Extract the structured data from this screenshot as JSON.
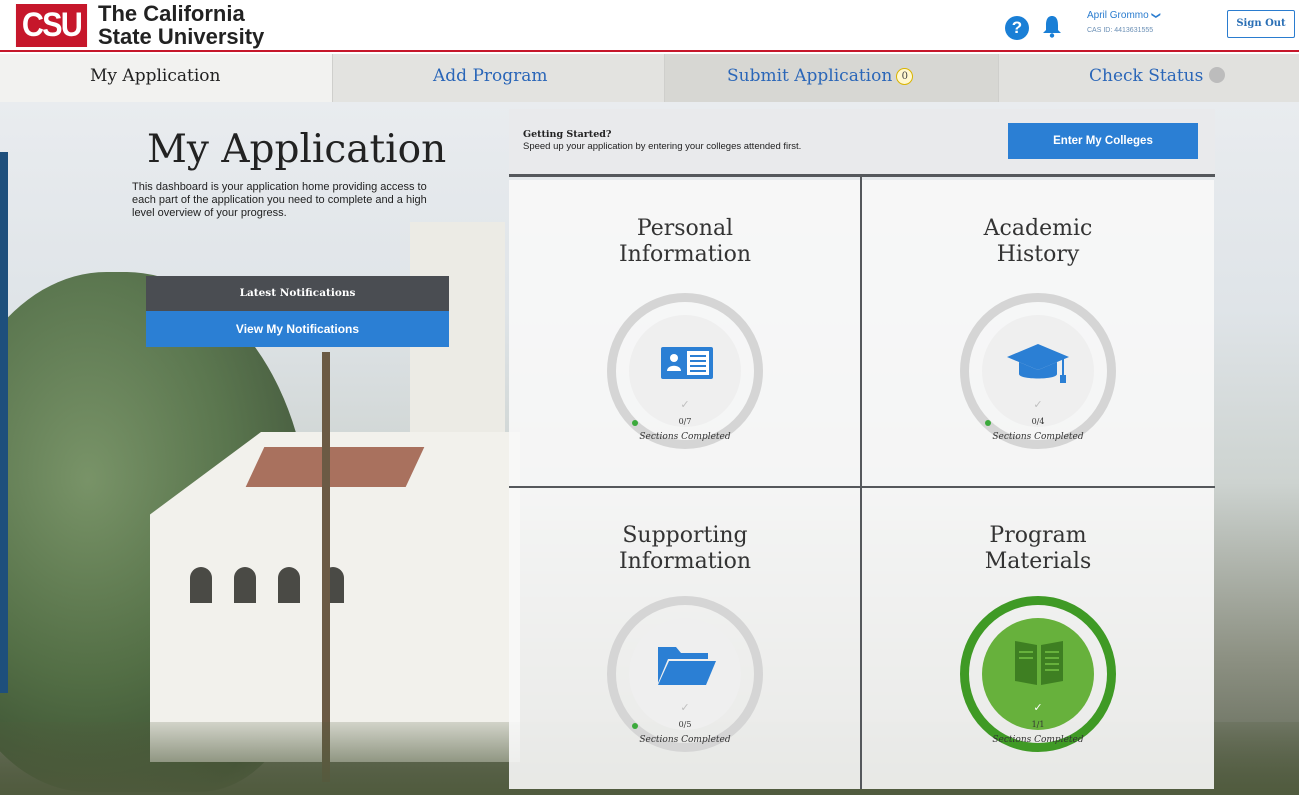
{
  "brand": {
    "logo_text": "CSU",
    "title_line1": "The California",
    "title_line2": "State University",
    "accent_color": "#c6172b"
  },
  "header": {
    "help_icon": "question-circle-icon",
    "help_glyph": "?",
    "bell_icon": "bell-icon",
    "user_name": "April Grommo",
    "user_caret": "❯",
    "cas_id": "CAS ID: 4413631555",
    "sign_out": "Sign Out"
  },
  "tabs": [
    {
      "label": "My Application",
      "active": true
    },
    {
      "label": "Add Program"
    },
    {
      "label": "Submit Application",
      "count": "0"
    },
    {
      "label": "Check Status",
      "status_icon": "status-dot-icon"
    }
  ],
  "intro": {
    "title": "My Application",
    "description": "This dashboard is your application home providing access to each part of the application you need to complete and a high level overview of your progress."
  },
  "notifications": {
    "heading": "Latest Notifications",
    "button": "View My Notifications"
  },
  "getting_started": {
    "title": "Getting Started?",
    "description": "Speed up your application by entering your colleges attended first.",
    "button": "Enter My Colleges"
  },
  "cards": [
    {
      "title_line1": "Personal",
      "title_line2": "Information",
      "icon": "id-card-icon",
      "count": "0/7",
      "label": "Sections Completed",
      "completed": false
    },
    {
      "title_line1": "Academic",
      "title_line2": "History",
      "icon": "graduation-cap-icon",
      "count": "0/4",
      "label": "Sections Completed",
      "completed": false
    },
    {
      "title_line1": "Supporting",
      "title_line2": "Information",
      "icon": "folder-icon",
      "count": "0/5",
      "label": "Sections Completed",
      "completed": false
    },
    {
      "title_line1": "Program",
      "title_line2": "Materials",
      "icon": "book-icon",
      "count": "1/1",
      "label": "Sections Completed",
      "completed": true
    }
  ],
  "check_glyph": "✓",
  "colors": {
    "primary_blue": "#2b7fd4",
    "complete_green": "#67b13c",
    "dark_gray": "#4a4d52"
  }
}
